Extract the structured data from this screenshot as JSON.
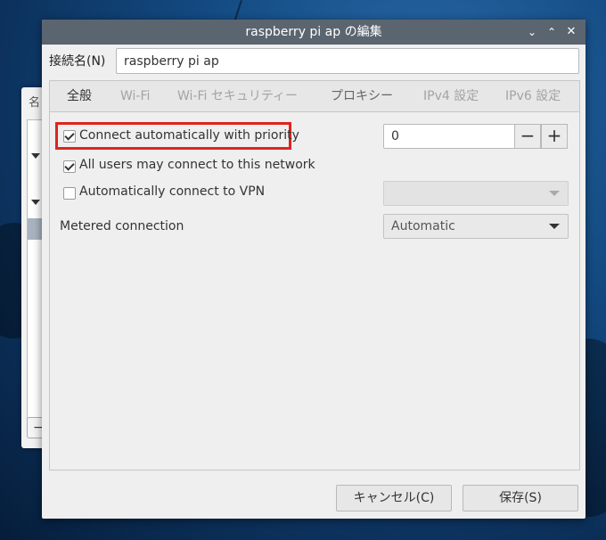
{
  "window": {
    "title": "raspberry pi ap の編集",
    "controls": [
      "chevron-down-icon",
      "chevron-up-icon",
      "close-icon"
    ]
  },
  "background_window": {
    "header_text": "名"
  },
  "connection_name": {
    "label": "接続名(N)",
    "value": "raspberry pi ap"
  },
  "tabs": [
    {
      "label": "全般",
      "active": true
    },
    {
      "label": "Wi-Fi",
      "active": false
    },
    {
      "label": "Wi-Fi セキュリティー",
      "active": false
    },
    {
      "label": "プロキシー",
      "active": false
    },
    {
      "label": "IPv4 設定",
      "active": false
    },
    {
      "label": "IPv6 設定",
      "active": false
    }
  ],
  "general": {
    "auto_connect": {
      "label": "Connect automatically with priority",
      "checked": true
    },
    "priority": {
      "value": "0",
      "decrement": "−",
      "increment": "+"
    },
    "all_users": {
      "label": "All users may connect to this network",
      "checked": true
    },
    "auto_vpn": {
      "label": "Automatically connect to VPN",
      "checked": false
    },
    "metered": {
      "label": "Metered connection",
      "value": "Automatic"
    }
  },
  "buttons": {
    "cancel": "キャンセル(C)",
    "save": "保存(S)"
  },
  "colors": {
    "titlebar": "#5b6570",
    "highlight": "#e0231e",
    "dialog_bg": "#efefef"
  }
}
